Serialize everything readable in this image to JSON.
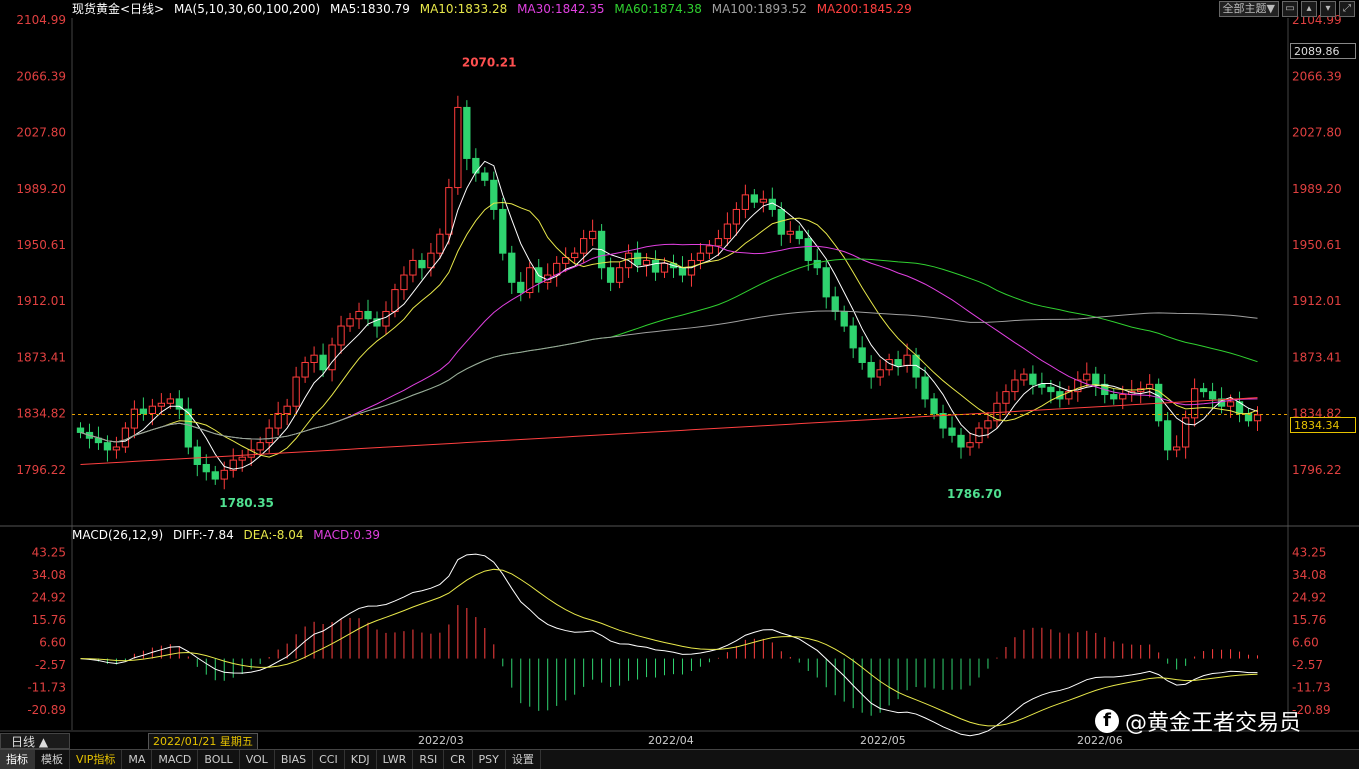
{
  "header": {
    "symbol": "现货黄金<日线>",
    "ma_params": "MA(5,10,30,60,100,200)",
    "ma5": "MA5:1830.79",
    "ma10": "MA10:1833.28",
    "ma30": "MA30:1842.35",
    "ma60": "MA60:1874.38",
    "ma100": "MA100:1893.52",
    "ma200": "MA200:1845.29",
    "theme_button": "全部主题▼",
    "colors": {
      "ma5": "#ffffff",
      "ma10": "#e8e84a",
      "ma30": "#e040e0",
      "ma60": "#30d030",
      "ma100": "#a0a0a0",
      "ma200": "#ff4040"
    }
  },
  "price_boxes": {
    "top": "2089.86",
    "current": "1834.34"
  },
  "macd_header": {
    "label": "MACD(26,12,9)",
    "diff": "DIFF:-7.84",
    "dea": "DEA:-8.04",
    "macd": "MACD:0.39"
  },
  "chart_data": [
    {
      "type": "candlestick",
      "title": "现货黄金<日线>",
      "y_ticks": [
        "2104.99",
        "2066.39",
        "2027.80",
        "1989.20",
        "1950.61",
        "1912.01",
        "1873.41",
        "1834.82",
        "1796.22"
      ],
      "ylim": [
        1780,
        2110
      ],
      "x_labels": [
        "2022/03",
        "2022/04",
        "2022/05",
        "2022/06"
      ],
      "annotations": [
        {
          "label": "2070.21",
          "value": 2070.21,
          "type": "high"
        },
        {
          "label": "1780.35",
          "value": 1780.35,
          "type": "low"
        },
        {
          "label": "1786.70",
          "value": 1786.7,
          "type": "low"
        }
      ],
      "current_price": 1834.34,
      "closes": [
        1822,
        1818,
        1815,
        1810,
        1812,
        1825,
        1838,
        1835,
        1840,
        1842,
        1845,
        1838,
        1812,
        1800,
        1795,
        1790,
        1796,
        1803,
        1805,
        1810,
        1815,
        1825,
        1835,
        1840,
        1860,
        1870,
        1875,
        1865,
        1882,
        1895,
        1900,
        1905,
        1900,
        1895,
        1905,
        1920,
        1930,
        1940,
        1935,
        1945,
        1958,
        1990,
        2045,
        2010,
        2000,
        1995,
        1975,
        1945,
        1925,
        1918,
        1935,
        1925,
        1930,
        1938,
        1942,
        1945,
        1955,
        1960,
        1935,
        1925,
        1935,
        1945,
        1937,
        1940,
        1932,
        1938,
        1935,
        1930,
        1940,
        1945,
        1950,
        1955,
        1965,
        1975,
        1985,
        1980,
        1982,
        1975,
        1958,
        1960,
        1955,
        1940,
        1935,
        1915,
        1905,
        1895,
        1880,
        1870,
        1860,
        1865,
        1872,
        1868,
        1875,
        1860,
        1845,
        1835,
        1825,
        1820,
        1812,
        1815,
        1825,
        1830,
        1842,
        1850,
        1858,
        1862,
        1855,
        1853,
        1850,
        1845,
        1850,
        1858,
        1862,
        1855,
        1848,
        1845,
        1848,
        1850,
        1852,
        1855,
        1830,
        1810,
        1812,
        1832,
        1852,
        1850,
        1845,
        1840,
        1843,
        1835,
        1830,
        1834
      ]
    },
    {
      "type": "bar",
      "title": "MACD(26,12,9)",
      "y_ticks": [
        "43.25",
        "34.08",
        "24.92",
        "15.76",
        "6.60",
        "-2.57",
        "-11.73",
        "-20.89"
      ],
      "ylim": [
        -25,
        45
      ]
    }
  ],
  "bottom_tabs": [
    "指标",
    "模板",
    "VIP指标",
    "MA",
    "MACD",
    "BOLL",
    "VOL",
    "BIAS",
    "CCI",
    "KDJ",
    "LWR",
    "RSI",
    "CR",
    "PSY",
    "设置"
  ],
  "period_button": "日线 ▲",
  "date_tip": "2022/01/21 星期五",
  "watermark": "@黄金王者交易员"
}
